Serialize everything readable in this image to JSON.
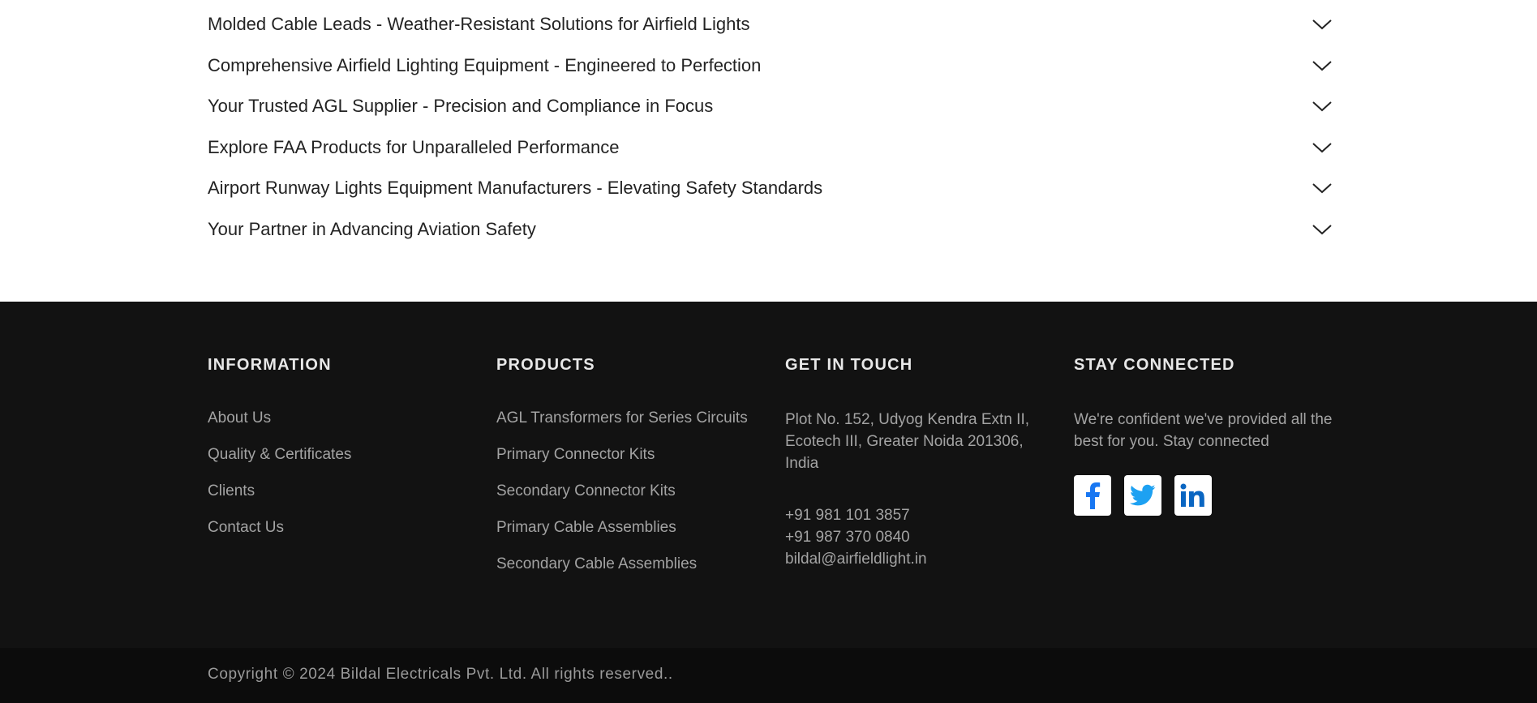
{
  "faq": {
    "items": [
      {
        "question": "Molded Cable Leads - Weather-Resistant Solutions for Airfield Lights",
        "icon": "chevron-down-icon"
      },
      {
        "question": "Comprehensive Airfield Lighting Equipment - Engineered to Perfection",
        "icon": "chevron-down-icon"
      },
      {
        "question": "Your Trusted AGL Supplier - Precision and Compliance in Focus",
        "icon": "chevron-down-icon"
      },
      {
        "question": "Explore FAA Products for Unparalleled Performance",
        "icon": "chevron-down-icon"
      },
      {
        "question": "Airport Runway Lights Equipment Manufacturers - Elevating Safety Standards",
        "icon": "chevron-down-icon"
      },
      {
        "question": "Your Partner in Advancing Aviation Safety",
        "icon": "chevron-down-icon"
      }
    ]
  },
  "footer": {
    "information": {
      "heading": "INFORMATION",
      "links": [
        "About Us",
        "Quality & Certificates",
        "Clients",
        "Contact Us"
      ]
    },
    "products": {
      "heading": "PRODUCTS",
      "links": [
        "AGL Transformers for Series Circuits",
        "Primary Connector Kits",
        "Secondary Connector Kits",
        "Primary Cable Assemblies",
        "Secondary Cable Assemblies"
      ]
    },
    "contact": {
      "heading": "GET IN TOUCH",
      "address": "Plot No. 152, Udyog Kendra Extn II, Ecotech III, Greater Noida 201306, India",
      "phone1": "+91 981 101 3857",
      "phone2": "+91 987 370 0840",
      "email": "bildal@airfieldlight.in"
    },
    "stay_connected": {
      "heading": "STAY CONNECTED",
      "text": "We're confident we've provided all the best for you. Stay connected",
      "social": [
        {
          "name": "facebook-icon",
          "color": "#1877f2"
        },
        {
          "name": "twitter-icon",
          "color": "#1da1f2"
        },
        {
          "name": "linkedin-icon",
          "color": "#0a66c2"
        }
      ]
    }
  },
  "copyright": "Copyright © 2024 Bildal Electricals Pvt. Ltd. All rights reserved..",
  "colors": {
    "footer_bg": "#121212",
    "copyright_bg": "#0c0c0c",
    "heading": "#e8e8e8",
    "link": "#a3a3a3"
  }
}
